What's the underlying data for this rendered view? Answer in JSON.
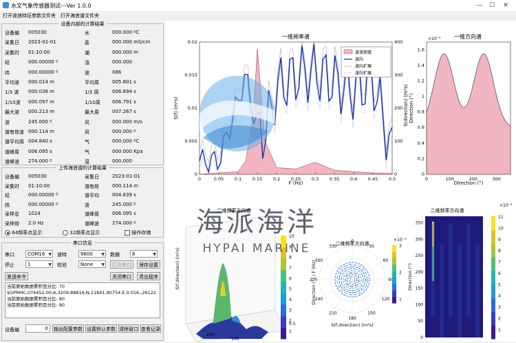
{
  "window": {
    "title": "水文气象传感器测试---Ver 1.0.0",
    "min": "—",
    "max": "☐",
    "close": "✕"
  },
  "menu": {
    "item1": "打开波浪特征参数文件夹",
    "item2": "打开海浪谱文件夹"
  },
  "internal": {
    "title": "设备内部的计算结果",
    "rows": [
      {
        "l1": "设备编",
        "v1": "005030",
        "l2": "水",
        "v2": "000.000 ºC"
      },
      {
        "l1": "采集日",
        "v1": "2023-01-01",
        "l2": "盐",
        "v2": "000.000 mS/cm"
      },
      {
        "l1": "采集时",
        "v1": "01:10:00",
        "l2": "潮",
        "v2": "000.000 m"
      },
      {
        "l1": "经",
        "v1": "000.00000 º",
        "l2": "浊",
        "v2": "000.000"
      },
      {
        "l1": "纬",
        "v1": "000.00000 º",
        "l2": "波",
        "v2": "086"
      },
      {
        "l1": "平均波",
        "v1": "000.014 m",
        "l2": "平均周",
        "v2": "005.601 s"
      },
      {
        "l1": "1/3 波",
        "v1": "000.036 m",
        "l2": "1/3 周",
        "v2": "006.694 s"
      },
      {
        "l1": "1/10波",
        "v1": "000.097 m",
        "l2": "1/10周",
        "v2": "006.791 s"
      },
      {
        "l1": "最大波",
        "v1": "000.213 m",
        "l2": "最大周",
        "v2": "007.267 s"
      },
      {
        "l1": "波",
        "v1": "245.000 º",
        "l2": "风",
        "v2": "000.000 m/s"
      },
      {
        "l1": "谱有效波",
        "v1": "000.114 m",
        "l2": "风",
        "v2": "000.000 º"
      },
      {
        "l1": "谱平均周",
        "v1": "004.840 s",
        "l2": "气",
        "v2": "000.000 ºC"
      },
      {
        "l1": "谱峰周",
        "v1": "006.095 s",
        "l2": "气",
        "v2": "000.000 Kpa"
      },
      {
        "l1": "谱峰波",
        "v1": "274.000 º",
        "l2": "湿",
        "v2": "000.000"
      }
    ]
  },
  "upper": {
    "title": "上传海浪谱的计算结果",
    "rows": [
      {
        "l1": "设备编",
        "v1": "005030",
        "l2": "采集日",
        "v2": "2023-01-01"
      },
      {
        "l1": "采集时",
        "v1": "01:10:00",
        "l2": "谱有效",
        "v2": "000.114 m"
      },
      {
        "l1": "经",
        "v1": "000.00000 º",
        "l2": "谱平均",
        "v2": "004.839 s"
      },
      {
        "l1": "纬",
        "v1": "000.00000 º",
        "l2": "波",
        "v2": "245.000 º"
      },
      {
        "l1": "采样总",
        "v1": "1024",
        "l2": "谱峰周",
        "v2": "006.095 s"
      },
      {
        "l1": "采样频",
        "v1": "2.0 Hz",
        "l2": "谱峰波",
        "v2": "274.000 º"
      }
    ],
    "radio64": "64频率点显示",
    "radio32": "32频率点显示",
    "check": "操作存储"
  },
  "serial": {
    "title": "串口信息",
    "port_label": "串口",
    "port_value": "COM16",
    "baud_label": "波特",
    "baud_value": "9600",
    "data_label": "数据",
    "data_value": "8",
    "stop_label": "停止",
    "stop_value": "1",
    "parity_label": "校验",
    "parity_value": "None",
    "open_btn": "打开串口",
    "save_btn": "保存设置",
    "send_btn": "发送命令",
    "close_btn": "关闭串口",
    "exit_btn": "退出程序",
    "log": [
      "当前原始数据累积百分比: 70",
      "$GPRMC,074452.00,A,3209.88816,N,11841.90754,E,0.016,,26122",
      "当前原始数据累积百分比: 80",
      "",
      "当前原始数据累积百分比: 90"
    ],
    "device_label": "设备编",
    "device_value": "0",
    "b1": "输出配置参数",
    "b2": "设置默认参数",
    "b3": "清除窗口",
    "b4": "查看记录"
  },
  "plots": {
    "p1": {
      "title": "一维频率谱",
      "ylabel_left": "S(f) (m²s)",
      "ylabel_right": "Direction (°)",
      "xlabel": "F (Hz)",
      "legend": [
        "波浪密度",
        "波向",
        "波向扩展",
        "波向扩展"
      ],
      "xticks": [
        "0",
        "0.05",
        "0.1",
        "0.15",
        "0.2",
        "0.25",
        "0.3",
        "0.35",
        "0.4",
        "0.45",
        "0.5"
      ],
      "yticks_left": [
        "0",
        "0.005",
        "0.01",
        "0.015",
        "0.02"
      ],
      "yticks_right": [
        "0",
        "100",
        "200",
        "300",
        "400"
      ]
    },
    "p2": {
      "title": "一维方向谱",
      "ylabel": "S(direction) (m²s)",
      "xlabel": "Direction (°)",
      "exponent": "×10⁻⁴",
      "xticks": [
        "0",
        "100",
        "200",
        "300"
      ],
      "yticks": [
        "0",
        "0.2",
        "0.4",
        "0.6",
        "0.8",
        "1",
        "1.2",
        "1.4",
        "1.6"
      ]
    },
    "p3": {
      "title": "二维频率方向谱",
      "zlabel": "S(f,direction) (m²s)",
      "ylabel": "Direction (°) / F (Hz)",
      "ticks": [
        "200",
        "100",
        "0.5"
      ],
      "cbar": [
        "10",
        "9",
        "8",
        "7",
        "6",
        "5",
        "4",
        "3",
        "2",
        "1"
      ]
    },
    "p4": {
      "title": "二维频率方向谱",
      "exponent": "×10⁻³",
      "xlabel": "S(f,direction) (m²s)",
      "angles": [
        "0",
        "30",
        "60",
        "90",
        "120",
        "150",
        "180",
        "210",
        "240",
        "270",
        "300",
        "330"
      ],
      "cbar": [
        "3",
        "2",
        "1"
      ]
    },
    "p5": {
      "title": "二维频率方向谱",
      "ylabel": "Direction (°)",
      "exponent": "×10⁻³",
      "yticks": [
        "0",
        "50",
        "100",
        "150",
        "200",
        "250",
        "300",
        "350"
      ],
      "cbar": [
        "11",
        "10",
        "9",
        "8",
        "7",
        "6",
        "5",
        "4",
        "3",
        "2",
        "1"
      ]
    }
  },
  "watermark": {
    "cn": "海派海洋",
    "en": "HYPAI MARINE"
  },
  "chart_data": {
    "type": "line",
    "title": "一维频率谱",
    "x": [
      0.05,
      0.1,
      0.12,
      0.14,
      0.15,
      0.17,
      0.2,
      0.25,
      0.3,
      0.35,
      0.4,
      0.45,
      0.5
    ],
    "series": [
      {
        "name": "波浪密度",
        "values": [
          0.0002,
          0.0004,
          0.002,
          0.009,
          0.019,
          0.005,
          0.001,
          0.0008,
          0.0018,
          0.0006,
          0.0004,
          0.0002,
          0.0001
        ]
      },
      {
        "name": "波向",
        "values": [
          40,
          220,
          300,
          180,
          150,
          120,
          260,
          300,
          310,
          280,
          250,
          290,
          60
        ]
      }
    ],
    "ylim": [
      0,
      0.02
    ],
    "ylim_right": [
      0,
      400
    ]
  }
}
